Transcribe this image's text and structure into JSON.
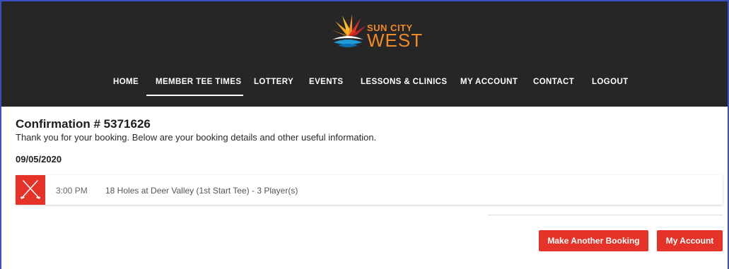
{
  "logo": {
    "line1": "SUN CITY",
    "line2": "WEST",
    "accent": "#f08a24"
  },
  "nav": {
    "items": [
      {
        "label": "HOME",
        "active": false
      },
      {
        "label": "MEMBER TEE TIMES",
        "active": true
      },
      {
        "label": "LOTTERY",
        "active": false
      },
      {
        "label": "EVENTS",
        "active": false
      },
      {
        "label": "LESSONS & CLINICS",
        "active": false
      },
      {
        "label": "MY ACCOUNT",
        "active": false
      },
      {
        "label": "CONTACT",
        "active": false
      },
      {
        "label": "LOGOUT",
        "active": false
      }
    ]
  },
  "confirmation": {
    "title": "Confirmation # 5371626",
    "subtitle": "Thank you for your booking. Below are your booking details and other useful information."
  },
  "booking": {
    "date": "09/05/2020",
    "icon": "golf-clubs-icon",
    "time": "3:00 PM",
    "description": "18 Holes at Deer Valley (1st Start Tee) - 3 Player(s)"
  },
  "actions": {
    "make_another_booking": "Make Another Booking",
    "my_account": "My Account"
  },
  "colors": {
    "header_bg": "#262626",
    "brand_red": "#e5332a",
    "frame_border": "#3b4fc4"
  }
}
